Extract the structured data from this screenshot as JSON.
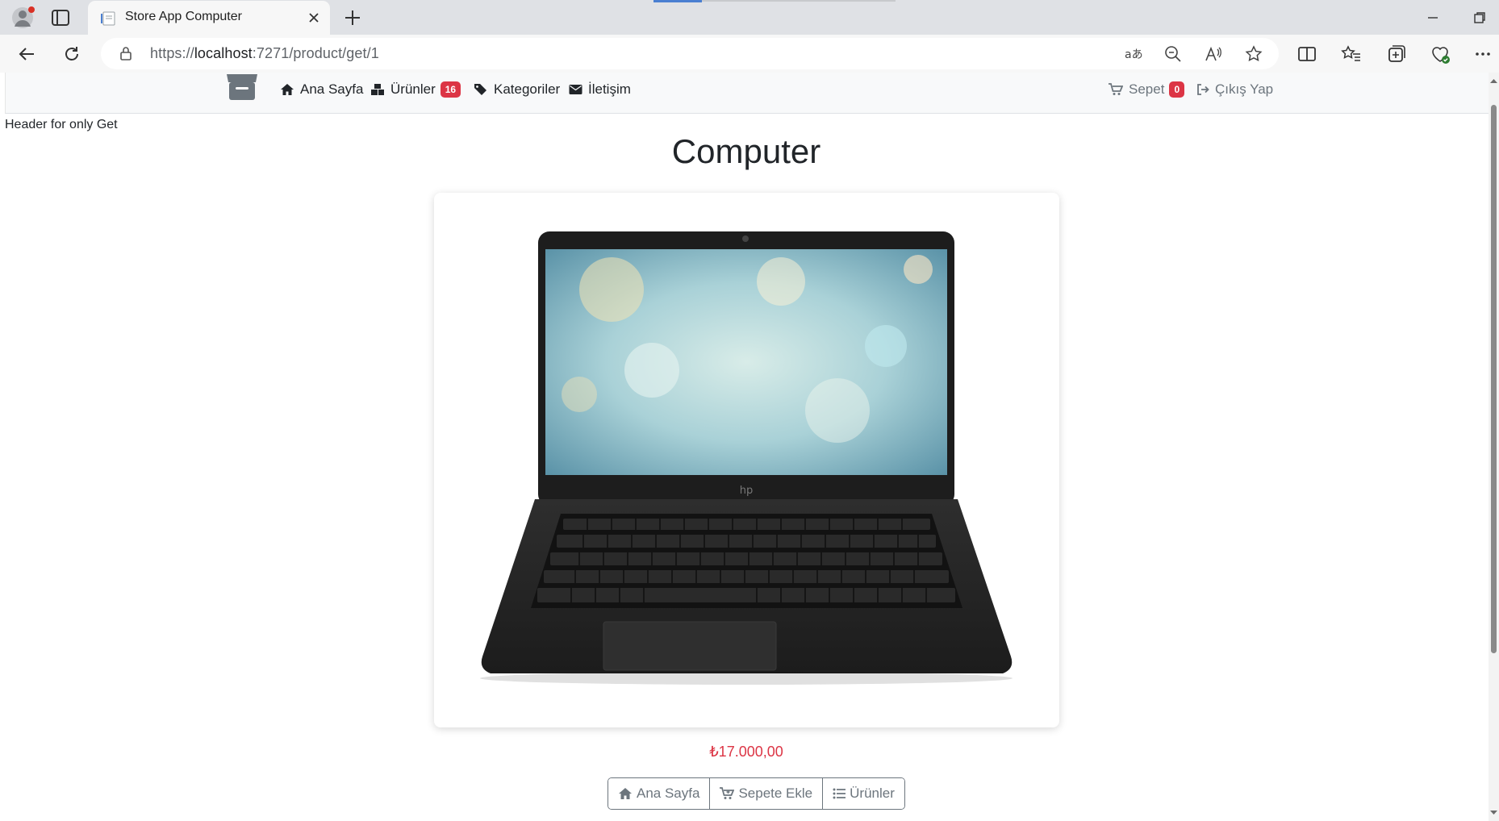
{
  "browser": {
    "tab_title": "Store App Computer",
    "url_prefix": "https://",
    "url_host": "localhost",
    "url_rest": ":7271/product/get/1"
  },
  "site_nav": {
    "items": [
      {
        "label": "Ana Sayfa",
        "icon": "house-icon"
      },
      {
        "label": "Ürünler",
        "icon": "boxes-icon",
        "badge": "16"
      },
      {
        "label": "Kategoriler",
        "icon": "tags-icon"
      },
      {
        "label": "İletişim",
        "icon": "envelope-icon"
      }
    ],
    "cart_label": "Sepet",
    "cart_badge": "0",
    "logout_label": "Çıkış Yap"
  },
  "page": {
    "header_note": "Header for only Get",
    "product_title": "Computer",
    "price": "₺17.000,00",
    "buttons": {
      "home": "Ana Sayfa",
      "add_to_cart": "Sepete Ekle",
      "products": "Ürünler"
    }
  },
  "colors": {
    "accent_red": "#dc3545",
    "secondary": "#6c757d",
    "nav_bg": "#f8f9fa"
  }
}
